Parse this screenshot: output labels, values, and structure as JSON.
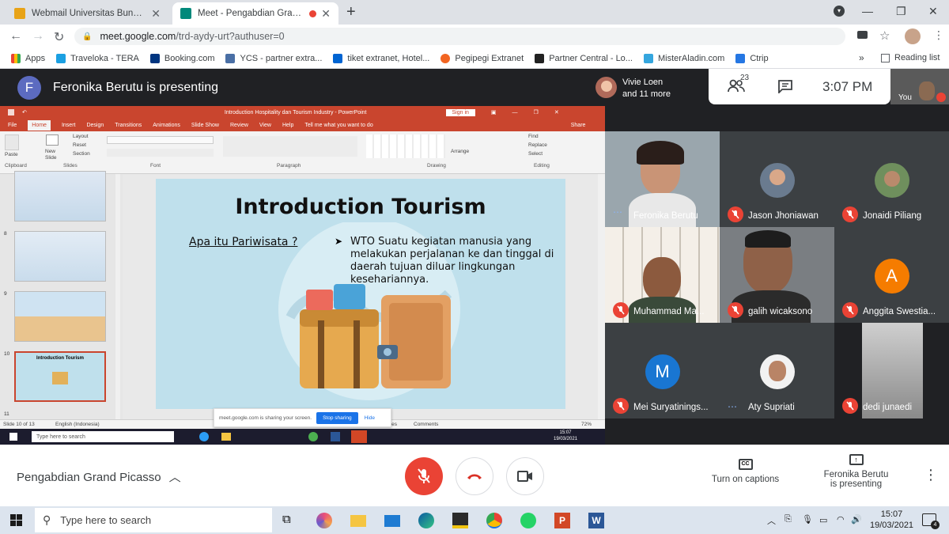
{
  "browser": {
    "tabs": [
      {
        "title": "Webmail Universitas Bunda Mulia",
        "active": false
      },
      {
        "title": "Meet - Pengabdian Grand Picasso",
        "active": true
      }
    ],
    "url_host": "meet.google.com",
    "url_path": "/trd-aydy-urt?authuser=0",
    "bookmarks": [
      "Apps",
      "Traveloka - TERA",
      "Booking.com",
      "YCS - partner extra...",
      "tiket extranet, Hotel...",
      "Pegipegi Extranet",
      "Partner Central - Lo...",
      "MisterAladin.com",
      "Ctrip"
    ],
    "reading_list": "Reading list"
  },
  "meet": {
    "presenter_initial": "F",
    "presenting_text": "Feronika Berutu is presenting",
    "top_participant": {
      "name": "Vivie Loen",
      "more": "and 11 more"
    },
    "participant_count": "23",
    "time": "3:07 PM",
    "you_label": "You",
    "participants": [
      {
        "name": "Feronika Berutu"
      },
      {
        "name": "Jason Jhoniawan"
      },
      {
        "name": "Jonaidi Piliang"
      },
      {
        "name": "Muhammad Ma..."
      },
      {
        "name": "galih wicaksono"
      },
      {
        "name": "Anggita Swestia..."
      },
      {
        "name": "Mei Suryatinings..."
      },
      {
        "name": "Aty Supriati"
      },
      {
        "name": "dedi junaedi"
      }
    ],
    "avatar_letters": {
      "anggita": "A",
      "mei": "M"
    },
    "colors": {
      "mute": "#ea4335",
      "anggita": "#f57c00",
      "mei": "#1976d2"
    }
  },
  "powerpoint": {
    "title": "Introduction Hospitality dan Tourism Industry - PowerPoint",
    "sign_in": "Sign in",
    "menu": [
      "File",
      "Home",
      "Insert",
      "Design",
      "Transitions",
      "Animations",
      "Slide Show",
      "Review",
      "View",
      "Help",
      "Tell me what you want to do"
    ],
    "share": "Share",
    "groups": [
      "Clipboard",
      "Slides",
      "Font",
      "Paragraph",
      "Drawing",
      "Editing"
    ],
    "ribbon": {
      "paste": "Paste",
      "new_slide": "New Slide",
      "layout": "Layout",
      "reset": "Reset",
      "section": "Section",
      "arrange": "Arrange",
      "find": "Find",
      "replace": "Replace",
      "select": "Select"
    },
    "thumb_numbers": [
      "8",
      "9",
      "10",
      "11"
    ],
    "thumb_title_10": "Introduction Tourism",
    "slide": {
      "title": "Introduction Tourism",
      "question": "Apa itu Pariwisata ?",
      "bullet": "WTO Suatu kegiatan manusia yang melakukan perjalanan ke dan tinggal di daerah tujuan diluar lingkungan kesehariannya."
    },
    "share_banner": "meet.google.com is sharing your screen.",
    "stop_sharing": "Stop sharing",
    "hide": "Hide",
    "status_left": "Slide 10 of 13",
    "status_lang": "English (Indonesia)",
    "status_notes": "Notes",
    "status_comments": "Comments",
    "zoom": "72%",
    "inner_search": "Type here to search",
    "inner_time": "15:07",
    "inner_date": "19/03/2021"
  },
  "bottom": {
    "meeting_name": "Pengabdian Grand Picasso",
    "captions": "Turn on captions",
    "presenting_line1": "Feronika Berutu",
    "presenting_line2": "is presenting"
  },
  "taskbar": {
    "search": "Type here to search",
    "time": "15:07",
    "date": "19/03/2021",
    "badge": "4"
  }
}
